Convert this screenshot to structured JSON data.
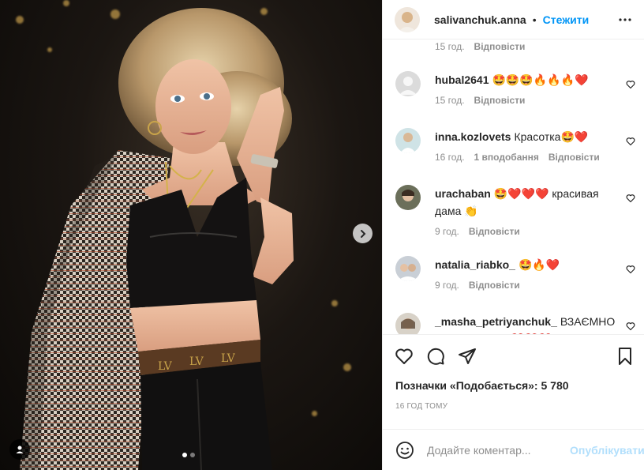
{
  "post": {
    "author": "salivanchuk.anna",
    "separator": "•",
    "follow_label": "Стежити",
    "more_icon": "more-horizontal-icon"
  },
  "comments": [
    {
      "user": "",
      "text": "",
      "time": "15 год.",
      "likes": "",
      "reply": "Відповісти"
    },
    {
      "user": "hubal2641",
      "text": "🤩🤩🤩🔥🔥🔥❤️",
      "time": "15 год.",
      "likes": "",
      "reply": "Відповісти"
    },
    {
      "user": "inna.kozlovets",
      "text": "Красотка🤩❤️",
      "time": "16 год.",
      "likes": "1 вподобання",
      "reply": "Відповісти"
    },
    {
      "user": "urachaban",
      "text": "🤩❤️❤️❤️ красивая дама 👏",
      "time": "9 год.",
      "likes": "",
      "reply": "Відповісти"
    },
    {
      "user": "natalia_riabko_",
      "text": "🤩🔥❤️",
      "time": "9 год.",
      "likes": "",
      "reply": "Відповісти"
    },
    {
      "user": "_masha_petriyanchuk_",
      "text": "ВЗАЄМНО ПІДПИСУЮСЯ❤️❤️❤️",
      "time": "",
      "likes": "",
      "reply": ""
    }
  ],
  "likes_text": "Позначки «Подобається»: 5 780",
  "timestamp": "16 ГОД ТОМУ",
  "add_comment": {
    "placeholder": "Додайте коментар...",
    "publish_label": "Опублікувати"
  },
  "carousel": {
    "current": 1,
    "total": 2
  },
  "colors": {
    "link_blue": "#0095f6",
    "publish_disabled": "#b2dffc",
    "muted": "#8e8e8e",
    "heart_red": "#ed4956"
  }
}
